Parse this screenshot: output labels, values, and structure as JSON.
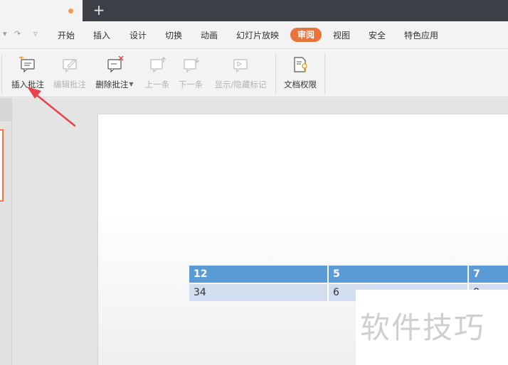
{
  "tabbar": {
    "new_tab_label": "+"
  },
  "quick_access": {
    "dropdown_glyph": "▾",
    "redo_glyph": "↷",
    "customize_glyph": "▿"
  },
  "menu": {
    "items": [
      "开始",
      "插入",
      "设计",
      "切换",
      "动画",
      "幻灯片放映",
      "审阅",
      "视图",
      "安全",
      "特色应用"
    ],
    "active": "审阅",
    "accent_color": "#e8743b"
  },
  "ribbon": {
    "insert_comment": {
      "label": "插入批注",
      "icon": "insert-comment-icon"
    },
    "edit_comment": {
      "label": "编辑批注",
      "icon": "edit-comment-icon"
    },
    "delete_comment": {
      "label": "删除批注",
      "icon": "delete-comment-icon"
    },
    "prev": {
      "label": "上一条",
      "icon": "previous-comment-icon"
    },
    "next": {
      "label": "下一条",
      "icon": "next-comment-icon"
    },
    "show_hide_marks": {
      "label": "显示/隐藏标记",
      "icon": "show-hide-marks-icon"
    },
    "doc_permissions": {
      "label": "文档权限",
      "icon": "document-permission-icon"
    }
  },
  "slide": {
    "table": {
      "header": [
        "12",
        "5",
        "7"
      ],
      "rows": [
        [
          "34",
          "6",
          "8"
        ]
      ],
      "header_color": "#5b9bd5",
      "row_color": "#d2deef"
    }
  },
  "watermark": {
    "text": "软件技巧"
  },
  "annotation": {
    "arrow_color": "#e8434a"
  }
}
